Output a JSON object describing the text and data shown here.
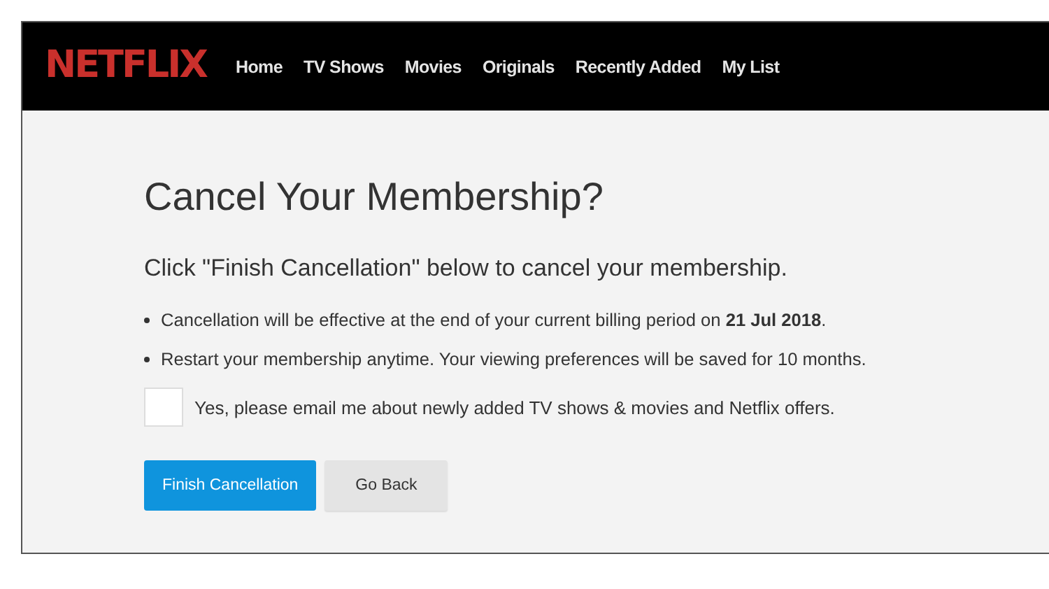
{
  "header": {
    "logo": "NETFLIX",
    "nav": [
      {
        "label": "Home"
      },
      {
        "label": "TV Shows"
      },
      {
        "label": "Movies"
      },
      {
        "label": "Originals"
      },
      {
        "label": "Recently Added"
      },
      {
        "label": "My List"
      }
    ]
  },
  "title": "Cancel Your Membership?",
  "subtitle": "Click \"Finish Cancellation\" below to cancel your membership.",
  "bullets": [
    "Cancellation will be effective at the end of your current billing period on **21 Jul 2018**.",
    "Restart your membership anytime. Your viewing preferences will be saved for 10 months."
  ],
  "email_opt_in": {
    "label": "Yes, please email me about newly added TV shows & movies and Netflix offers.",
    "checked": false
  },
  "buttons": [
    {
      "label": "Finish Cancellation",
      "kind": "primary"
    },
    {
      "label": "Go Back",
      "kind": "secondary"
    }
  ]
}
